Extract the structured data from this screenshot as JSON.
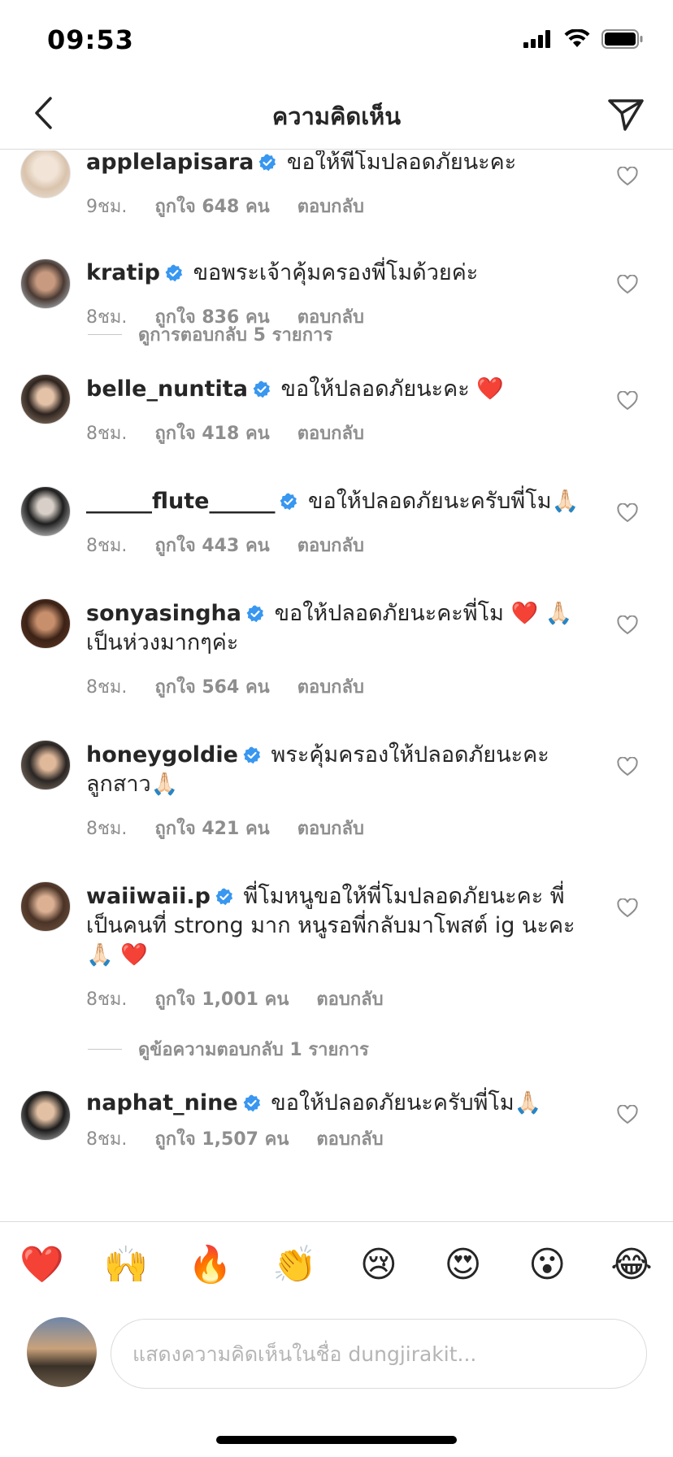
{
  "status_bar": {
    "time": "09:53"
  },
  "header": {
    "title": "ความคิดเห็น"
  },
  "comments": [
    {
      "username": "applelapisara",
      "text": "ขอให้พี่โมปลอดภัยนะคะ",
      "time": "9ชม.",
      "likes": "ถูกใจ 648 คน",
      "reply": "ตอบกลับ"
    },
    {
      "username": "kratip",
      "text": "ขอพระเจ้าคุ้มครองพี่โมด้วยค่ะ",
      "time": "8ชม.",
      "likes": "ถูกใจ 836 คน",
      "reply": "ตอบกลับ",
      "view_replies": "ดูการตอบกลับ 5 รายการ"
    },
    {
      "username": "belle_nuntita",
      "text": "ขอให้ปลอดภัยนะคะ ❤️",
      "time": "8ชม.",
      "likes": "ถูกใจ 418 คน",
      "reply": "ตอบกลับ"
    },
    {
      "username": "______flute______",
      "text": "ขอให้ปลอดภัยนะครับพี่โม🙏🏻",
      "time": "8ชม.",
      "likes": "ถูกใจ 443 คน",
      "reply": "ตอบกลับ"
    },
    {
      "username": "sonyasingha",
      "text": "ขอให้ปลอดภัยนะคะพี่โม ❤️ 🙏🏻 เป็นห่วงมากๆค่ะ",
      "time": "8ชม.",
      "likes": "ถูกใจ 564 คน",
      "reply": "ตอบกลับ"
    },
    {
      "username": "honeygoldie",
      "text": "พระคุ้มครองให้ปลอดภัยนะคะ ลูกสาว🙏🏻",
      "time": "8ชม.",
      "likes": "ถูกใจ 421 คน",
      "reply": "ตอบกลับ"
    },
    {
      "username": "waiiwaii.p",
      "text": "พี่โมหนูขอให้พี่โมปลอดภัยนะคะ พี่เป็นคนที่ strong มาก หนูรอพี่กลับมาโพสต์ ig นะคะ 🙏🏻 ❤️",
      "time": "8ชม.",
      "likes": "ถูกใจ 1,001 คน",
      "reply": "ตอบกลับ",
      "view_replies": "ดูข้อความตอบกลับ 1 รายการ"
    },
    {
      "username": "naphat_nine",
      "text": "ขอให้ปลอดภัยนะครับพี่โม🙏🏻",
      "time": "8ชม.",
      "likes": "ถูกใจ 1,507 คน",
      "reply": "ตอบกลับ"
    }
  ],
  "emoji_bar": [
    "❤️",
    "🙌",
    "🔥",
    "👏",
    "😢",
    "😍",
    "😮",
    "😂"
  ],
  "composer": {
    "placeholder": "แสดงความคิดเห็นในชื่อ dungjirakit..."
  }
}
